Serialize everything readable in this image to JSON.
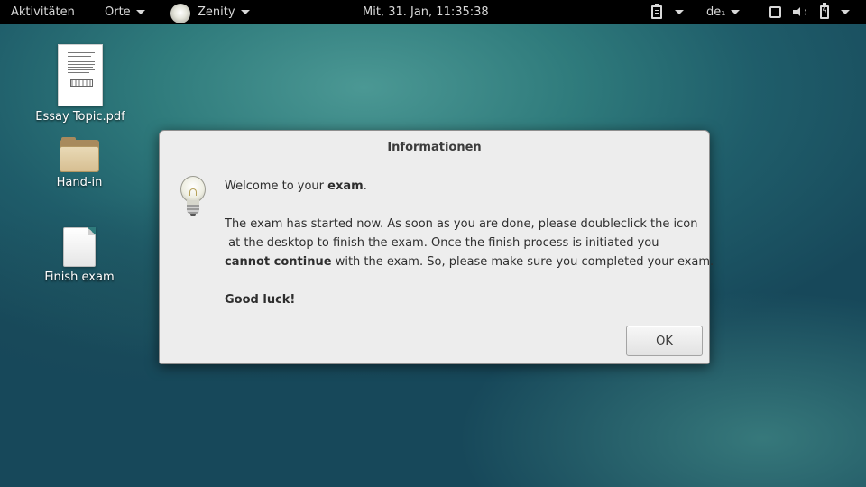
{
  "topbar": {
    "activities": "Aktivitäten",
    "places": "Orte",
    "app_name": "Zenity",
    "clock": "Mit, 31. Jan, 11:35:38",
    "keyboard_layout": "de₁",
    "icons": [
      "clipboard-icon",
      "window-icon",
      "speaker-icon",
      "battery-icon"
    ]
  },
  "desktop": {
    "icons": [
      {
        "label": "Essay Topic.pdf",
        "type": "pdf-document"
      },
      {
        "label": "Hand-in",
        "type": "folder"
      },
      {
        "label": "Finish exam",
        "type": "blank-document"
      }
    ]
  },
  "dialog": {
    "title": "Informationen",
    "icon": "lightbulb-icon",
    "line1_pre": "Welcome to your ",
    "line1_bold": "exam",
    "line1_post": ".",
    "line2": "The exam has started now. As soon as you are done, please doubleclick the icon",
    "line3": " at the desktop to finish the exam. Once the finish process is initiated you",
    "line4_bold": "cannot continue",
    "line4_post": " with the exam. So, please make sure you completed your exam.",
    "closing": "Good luck!",
    "ok_label": "OK"
  }
}
